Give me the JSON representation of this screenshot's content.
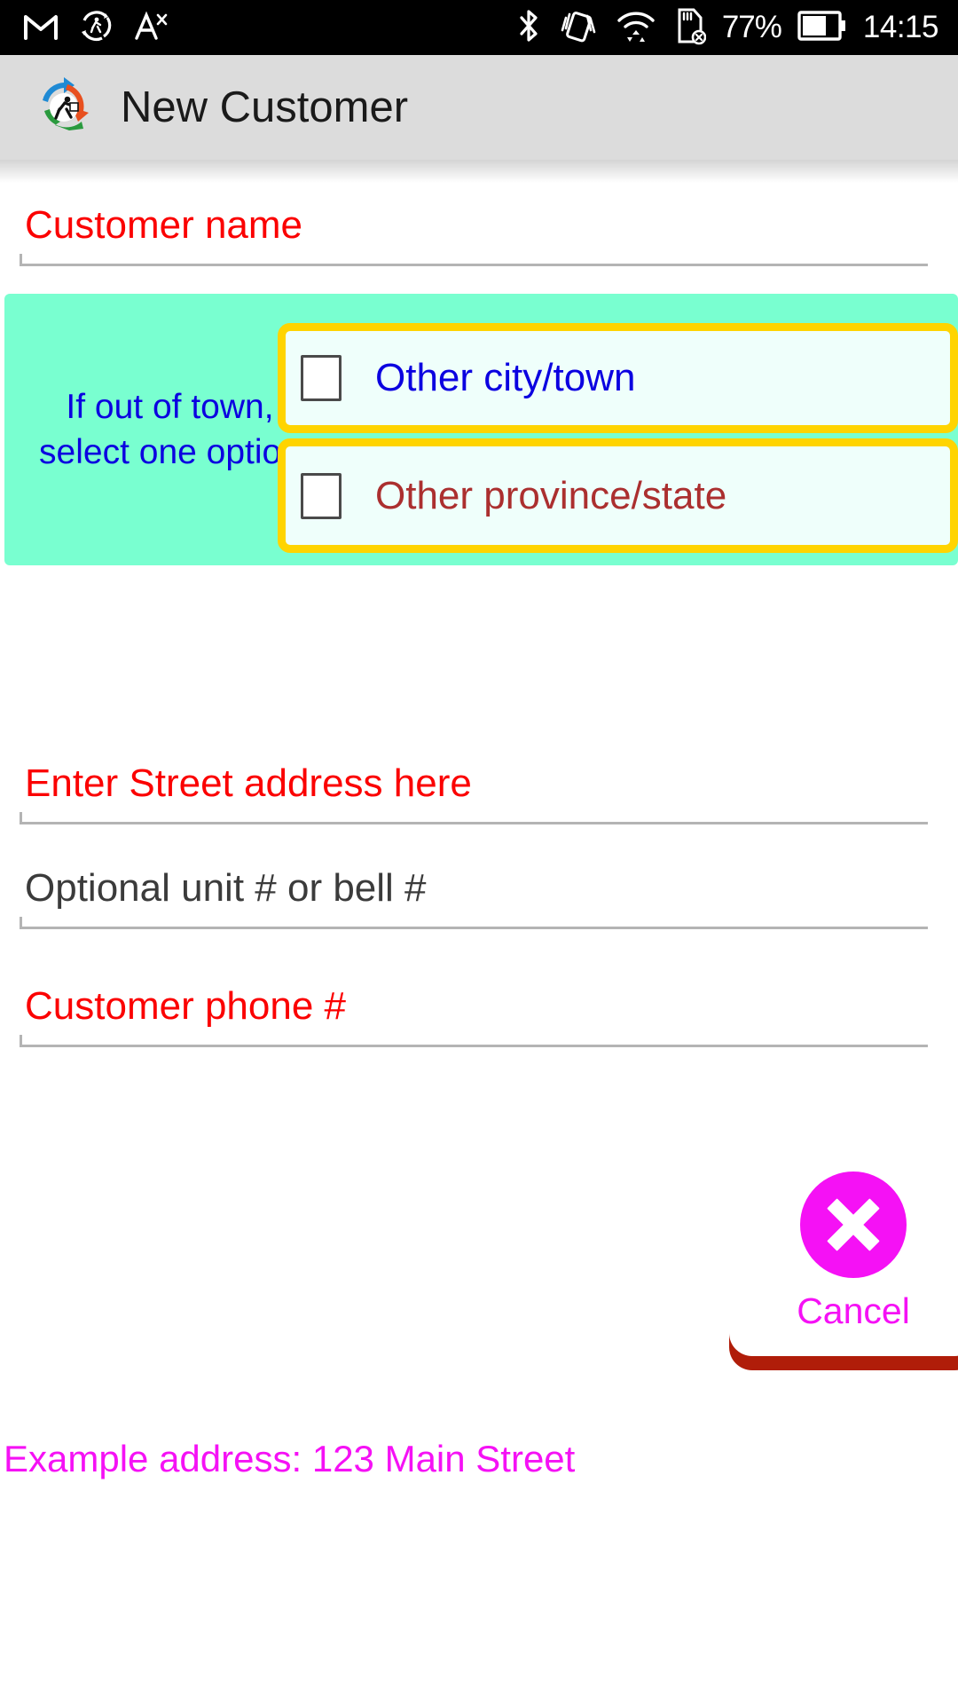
{
  "status_bar": {
    "left_icons": [
      {
        "name": "gmail-icon",
        "label": "M"
      },
      {
        "name": "courier-sync-icon",
        "label": "sync"
      },
      {
        "name": "font-size-icon",
        "label": "A"
      }
    ],
    "right_icons": [
      {
        "name": "bluetooth-icon",
        "label": "bluetooth"
      },
      {
        "name": "vibrate-icon",
        "label": "vibrate"
      },
      {
        "name": "wifi-icon",
        "label": "wifi"
      },
      {
        "name": "sd-card-removed-icon",
        "label": "no sd card"
      }
    ],
    "battery_percent": "77%",
    "clock": "14:15"
  },
  "app_bar": {
    "title": "New Customer",
    "logo_name": "courier-app-logo",
    "background": "#dcdcdc"
  },
  "form": {
    "customer_name": {
      "label": "Customer name",
      "value": "",
      "label_color": "#fb0000"
    },
    "out_of_town": {
      "note": "If out of town,\nselect one option",
      "note_line1": "If out of town,",
      "note_line2": "select one option",
      "note_color": "#0b00e0",
      "panel_color": "#79ffd0",
      "options": [
        {
          "label": "Other city/town",
          "checked": false,
          "label_color": "#0b00e0",
          "border_color": "#ffd400"
        },
        {
          "label": "Other province/state",
          "checked": false,
          "label_color": "#ab2f2f",
          "border_color": "#ffd400"
        }
      ]
    },
    "street_address": {
      "label": "Enter Street address here",
      "value": "",
      "label_color": "#fb0000"
    },
    "unit_number": {
      "label": "Optional unit # or bell #",
      "value": "",
      "label_color": "#3b3b3b"
    },
    "phone": {
      "label": "Customer phone #",
      "value": "",
      "label_color": "#fb0000"
    }
  },
  "actions": {
    "cancel": {
      "label": "Cancel",
      "icon": "close-x-icon",
      "accent_color": "#f511f5",
      "shadow_color": "#b01d09"
    }
  },
  "footer": {
    "example_note": "Example address: 123 Main Street",
    "color": "#f511f5"
  }
}
